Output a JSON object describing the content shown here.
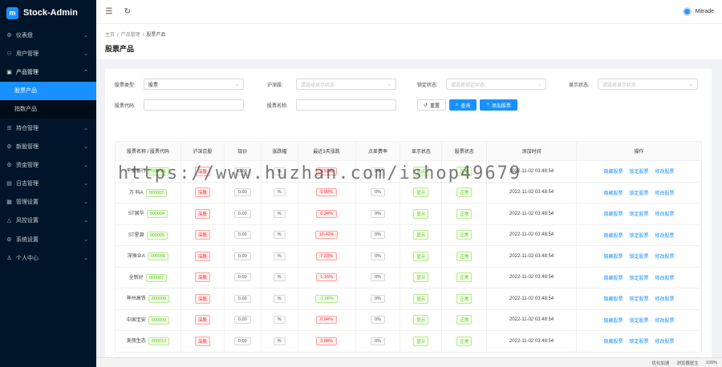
{
  "app": {
    "name": "Stock-Admin",
    "logo_letter": "m"
  },
  "sidebar": {
    "items": [
      {
        "label": "仪表盘",
        "icon": "⚙"
      },
      {
        "label": "用户管理",
        "icon": "⚇"
      },
      {
        "label": "产品管理",
        "icon": "▣",
        "open": true
      },
      {
        "label": "持仓管理",
        "icon": "☰"
      },
      {
        "label": "新股管理",
        "icon": "⚙"
      },
      {
        "label": "资金管理",
        "icon": "⚙"
      },
      {
        "label": "日志管理",
        "icon": "▤"
      },
      {
        "label": "管理设置",
        "icon": "▦"
      },
      {
        "label": "风控设置",
        "icon": "△"
      },
      {
        "label": "系统设置",
        "icon": "⚙"
      },
      {
        "label": "个人中心",
        "icon": "♙"
      }
    ],
    "sub_items": [
      {
        "label": "股票产品",
        "active": true
      },
      {
        "label": "指数产品",
        "active": false
      }
    ]
  },
  "header": {
    "username": "Mitrade"
  },
  "breadcrumb": [
    "主页",
    "产品管理",
    "股票产品"
  ],
  "page_title": "股票产品",
  "filters": {
    "stock_type_label": "股票类型:",
    "stock_type_value": "股票",
    "market_label": "沪深股:",
    "market_placeholder": "请选择显示状态",
    "lock_label": "锁定状态:",
    "lock_placeholder": "请选择锁定状态",
    "display_label": "显示状态:",
    "display_placeholder": "请选择显示状态",
    "code_label": "股票代码:",
    "name_label": "股票名称:",
    "reset_label": "重置",
    "query_label": "查询",
    "add_label": "添加股票"
  },
  "watermark": "https://www.huzhan.com/ishop49679",
  "table": {
    "columns": [
      "股票名称 / 股票代码",
      "沪深京股",
      "现价",
      "涨跌幅",
      "最近3天涨跌",
      "点差费率",
      "显示状态",
      "股票状态",
      "添加时间",
      "操作"
    ],
    "rows": [
      {
        "name": "平安银行",
        "code": "000001",
        "market": "深股",
        "price": "0.00",
        "change": "%",
        "recent": "4.51%",
        "recent_dir": "up",
        "spread": "0%",
        "display": "显示",
        "status": "正常",
        "time": "2022-11-02 03:48:54"
      },
      {
        "name": "万 科A",
        "code": "000002",
        "market": "深股",
        "price": "0.00",
        "change": "%",
        "recent": "5.99%",
        "recent_dir": "up",
        "spread": "0%",
        "display": "显示",
        "status": "正常",
        "time": "2022-11-02 03:48:54"
      },
      {
        "name": "ST国华",
        "code": "000004",
        "market": "深股",
        "price": "0.00",
        "change": "%",
        "recent": "0.24%",
        "recent_dir": "up",
        "spread": "0%",
        "display": "显示",
        "status": "正常",
        "time": "2022-11-02 03:48:54"
      },
      {
        "name": "ST星源",
        "code": "000005",
        "market": "深股",
        "price": "0.00",
        "change": "%",
        "recent": "10.42%",
        "recent_dir": "up",
        "spread": "0%",
        "display": "显示",
        "status": "正常",
        "time": "2022-11-02 03:48:54"
      },
      {
        "name": "深振业A",
        "code": "000006",
        "market": "深股",
        "price": "0.00",
        "change": "%",
        "recent": "7.33%",
        "recent_dir": "up",
        "spread": "0%",
        "display": "显示",
        "status": "正常",
        "time": "2022-11-02 03:48:54"
      },
      {
        "name": "全新好",
        "code": "000007",
        "market": "深股",
        "price": "0.00",
        "change": "%",
        "recent": "1.15%",
        "recent_dir": "up",
        "spread": "0%",
        "display": "显示",
        "status": "正常",
        "time": "2022-11-02 03:48:54"
      },
      {
        "name": "神州高铁",
        "code": "000008",
        "market": "深股",
        "price": "0.00",
        "change": "%",
        "recent": "-1.66%",
        "recent_dir": "down",
        "spread": "0%",
        "display": "显示",
        "status": "正常",
        "time": "2022-11-02 03:48:54"
      },
      {
        "name": "中国宝安",
        "code": "000009",
        "market": "深股",
        "price": "0.00",
        "change": "%",
        "recent": "0.94%",
        "recent_dir": "up",
        "spread": "0%",
        "display": "显示",
        "status": "正常",
        "time": "2022-11-02 03:48:54"
      },
      {
        "name": "美丽生态",
        "code": "000010",
        "market": "深股",
        "price": "0.00",
        "change": "%",
        "recent": "3.88%",
        "recent_dir": "up",
        "spread": "0%",
        "display": "显示",
        "status": "正常",
        "time": "2022-11-02 03:48:54"
      }
    ],
    "actions": [
      "隐藏股票",
      "锁定股票",
      "修改股票"
    ]
  },
  "statusbar": {
    "items": [
      "优化加速",
      "浏览器医生",
      "100%"
    ]
  },
  "colors": {
    "sidebar_bg": "#001529",
    "primary": "#1890ff",
    "up": "#f5222d",
    "down": "#52c41a"
  }
}
